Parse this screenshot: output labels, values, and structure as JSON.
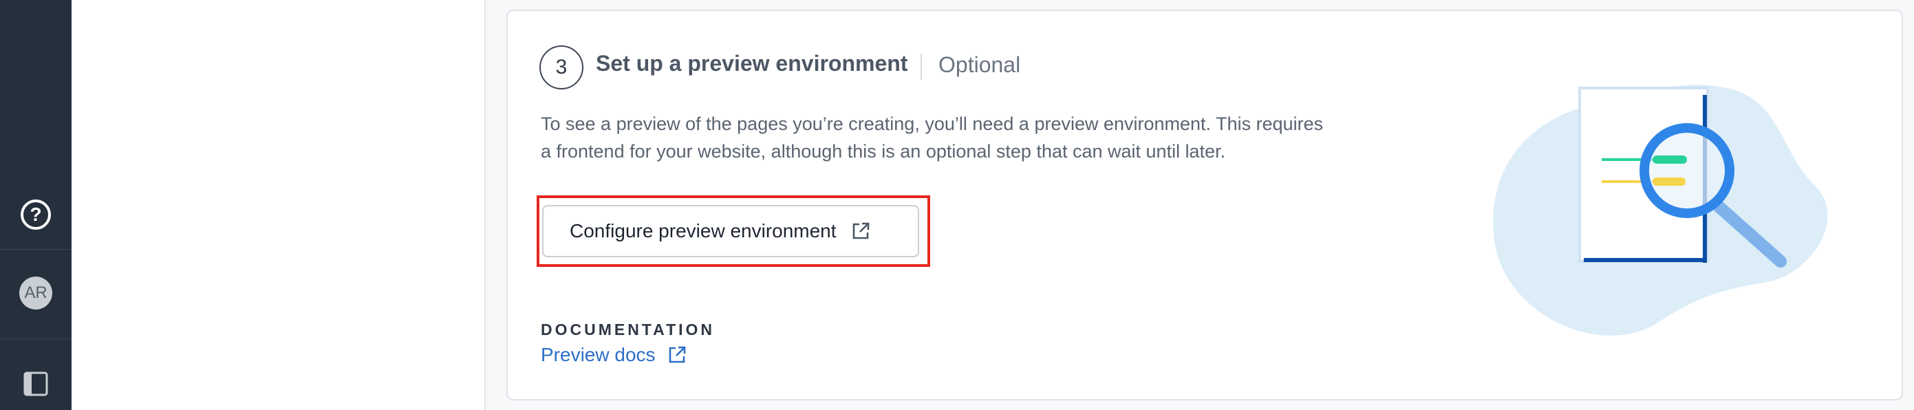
{
  "sidebar": {
    "help_icon_glyph": "?",
    "avatar_initials": "AR"
  },
  "step": {
    "number": "3",
    "title": "Set up a preview environment",
    "optional_label": "Optional",
    "description_line1": "To see a preview of the pages you’re creating, you’ll need a preview environment. This requires",
    "description_line2": "a frontend for your website, although this is an optional step that can wait until later.",
    "configure_button_label": "Configure preview environment"
  },
  "documentation": {
    "heading": "DOCUMENTATION",
    "link_label": "Preview docs"
  },
  "icons": {
    "help": "question-circle-icon",
    "external": "external-link-icon",
    "sidebar_toggle": "sidebar-toggle-icon",
    "illustration": "magnifier-document-illustration"
  },
  "colors": {
    "sidebar_bg": "#25303c",
    "link": "#2a6fc9",
    "highlight": "#e5281f",
    "accent_blue": "#2f86e8",
    "accent_green": "#27d19a",
    "accent_yellow": "#f5d34a"
  }
}
